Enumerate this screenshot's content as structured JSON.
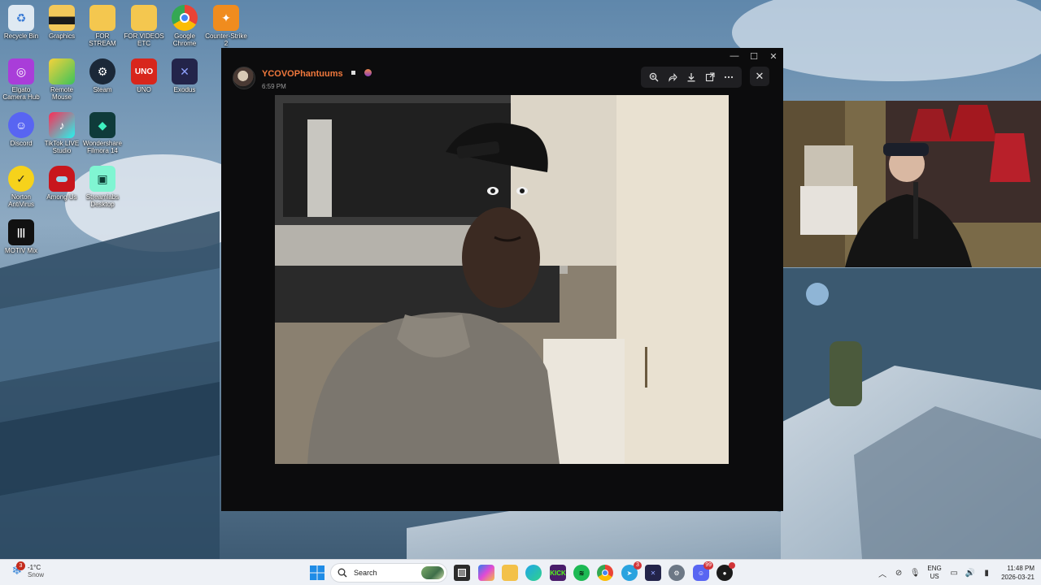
{
  "desktop": {
    "icons": [
      {
        "label": "Recycle Bin",
        "icon": "recycle-bin-icon"
      },
      {
        "label": "Graphics",
        "icon": "folder-icon"
      },
      {
        "label": "FOR STREAM",
        "icon": "folder-icon"
      },
      {
        "label": "FOR VIDEOS ETC",
        "icon": "folder-icon"
      },
      {
        "label": "Google Chrome",
        "icon": "chrome-icon"
      },
      {
        "label": "Counter-Strike 2",
        "icon": "counter-strike-icon"
      },
      {
        "label": "Elgato Camera Hub",
        "icon": "elgato-icon"
      },
      {
        "label": "Remote Mouse",
        "icon": "remote-mouse-icon"
      },
      {
        "label": "Steam",
        "icon": "steam-icon"
      },
      {
        "label": "UNO",
        "icon": "uno-icon"
      },
      {
        "label": "Exodus",
        "icon": "exodus-icon"
      },
      {
        "label": "Discord",
        "icon": "discord-icon"
      },
      {
        "label": "TikTok LIVE Studio",
        "icon": "tiktok-icon"
      },
      {
        "label": "Wondershare Filmora 14",
        "icon": "filmora-icon"
      },
      {
        "label": "Norton AntiVirus",
        "icon": "norton-icon"
      },
      {
        "label": "Among Us",
        "icon": "among-us-icon"
      },
      {
        "label": "Streamlabs Desktop",
        "icon": "streamlabs-icon"
      },
      {
        "label": "MOTIV Mix",
        "icon": "motiv-mix-icon"
      }
    ]
  },
  "viewer": {
    "poster_name": "YCOVOPhantuums",
    "post_time": "6:59 PM",
    "toolbar": [
      "zoom-icon",
      "forward-icon",
      "download-icon",
      "open-external-icon",
      "more-icon"
    ],
    "close_icon": "close-icon"
  },
  "taskbar": {
    "weather_badge": "3",
    "weather_temp": "-1°C",
    "weather_cond": "Snow",
    "search_label": "Search",
    "apps": [
      {
        "name": "task-view",
        "badge": ""
      },
      {
        "name": "copilot",
        "badge": ""
      },
      {
        "name": "file-explorer",
        "badge": ""
      },
      {
        "name": "edge",
        "badge": ""
      },
      {
        "name": "kick",
        "badge": ""
      },
      {
        "name": "spotify",
        "badge": ""
      },
      {
        "name": "chrome",
        "badge": ""
      },
      {
        "name": "telegram",
        "badge": "3"
      },
      {
        "name": "exodus",
        "badge": ""
      },
      {
        "name": "settings",
        "badge": ""
      },
      {
        "name": "discord",
        "badge": "99"
      },
      {
        "name": "obs",
        "badge": ""
      }
    ],
    "lang_top": "ENG",
    "lang_bottom": "US",
    "time": "11:48 PM",
    "date": "2026-03-21"
  }
}
